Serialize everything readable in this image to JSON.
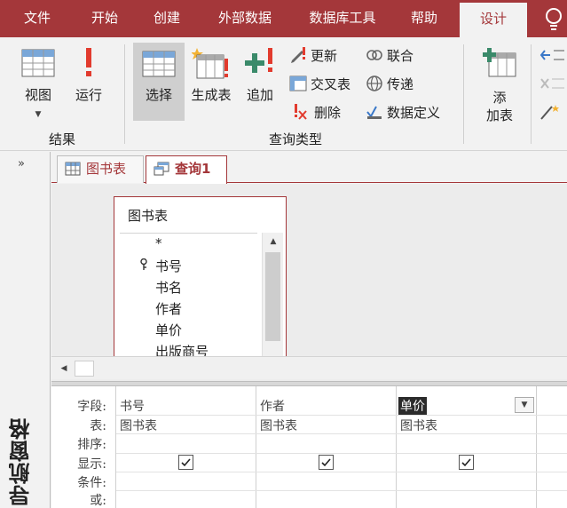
{
  "ribbon_tabs": [
    {
      "label": "文件"
    },
    {
      "label": "开始"
    },
    {
      "label": "创建"
    },
    {
      "label": "外部数据"
    },
    {
      "label": "数据库工具"
    },
    {
      "label": "帮助"
    },
    {
      "label": "设计",
      "active": true
    }
  ],
  "help_icon": "lightbulb-icon",
  "groups": {
    "results": {
      "label": "结果",
      "view_label": "视图",
      "run_label": "运行"
    },
    "query_type": {
      "label": "查询类型",
      "select_label": "选择",
      "make_table_label": "生成表",
      "append_label": "追加",
      "update_label": "更新",
      "crosstab_label": "交叉表",
      "delete_label": "删除",
      "union_label": "联合",
      "passthrough_label": "传递",
      "data_definition_label": "数据定义"
    },
    "setup": {
      "add_table_label_1": "添",
      "add_table_label_2": "加表"
    }
  },
  "nav_pane": {
    "chevron": "»",
    "title": "导航窗格"
  },
  "doc_tabs": [
    {
      "label": "图书表",
      "active": false
    },
    {
      "label": "查询1",
      "active": true
    }
  ],
  "table_box": {
    "title": "图书表",
    "fields": [
      "*",
      "书号",
      "书名",
      "作者",
      "单价",
      "出版商号"
    ]
  },
  "grid": {
    "row_labels": [
      "字段:",
      "表:",
      "排序:",
      "显示:",
      "条件:",
      "或:"
    ],
    "columns": [
      {
        "field": "书号",
        "table": "图书表",
        "show": true,
        "selected": false
      },
      {
        "field": "作者",
        "table": "图书表",
        "show": true,
        "selected": false
      },
      {
        "field": "单价",
        "table": "图书表",
        "show": true,
        "selected": true
      }
    ]
  },
  "colors": {
    "accent": "#a4373a",
    "tab_text": "#ffffff"
  }
}
